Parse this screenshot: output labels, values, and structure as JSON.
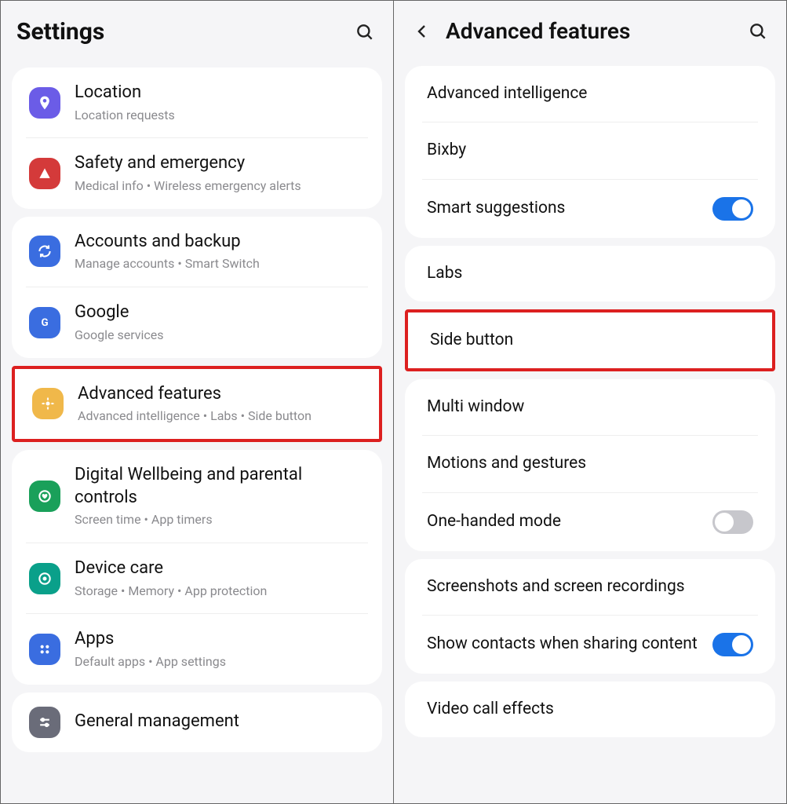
{
  "left": {
    "title": "Settings",
    "groups": [
      [
        {
          "icon": "location-icon",
          "iconClass": "ic-violet",
          "title": "Location",
          "sub": "Location requests"
        },
        {
          "icon": "warning-icon",
          "iconClass": "ic-red",
          "title": "Safety and emergency",
          "sub": "Medical info  •  Wireless emergency alerts"
        }
      ],
      [
        {
          "icon": "sync-icon",
          "iconClass": "ic-blue",
          "title": "Accounts and backup",
          "sub": "Manage accounts  •  Smart Switch"
        },
        {
          "icon": "google-icon",
          "iconClass": "ic-blue2",
          "title": "Google",
          "sub": "Google services"
        }
      ]
    ],
    "highlighted": {
      "icon": "gear-star-icon",
      "iconClass": "ic-yellow",
      "title": "Advanced features",
      "sub": "Advanced intelligence  •  Labs  •  Side button"
    },
    "groups2": [
      [
        {
          "icon": "heart-circle-icon",
          "iconClass": "ic-green",
          "title": "Digital Wellbeing and parental controls",
          "sub": "Screen time  •  App timers"
        },
        {
          "icon": "shield-check-icon",
          "iconClass": "ic-teal",
          "title": "Device care",
          "sub": "Storage  •  Memory  •  App protection"
        },
        {
          "icon": "apps-grid-icon",
          "iconClass": "ic-bluei",
          "title": "Apps",
          "sub": "Default apps  •  App settings"
        }
      ],
      [
        {
          "icon": "sliders-icon",
          "iconClass": "ic-grey",
          "title": "General management",
          "sub": ""
        }
      ]
    ]
  },
  "right": {
    "title": "Advanced features",
    "groups": [
      [
        {
          "title": "Advanced intelligence",
          "toggle": null
        },
        {
          "title": "Bixby",
          "toggle": null
        },
        {
          "title": "Smart suggestions",
          "toggle": "on"
        }
      ],
      [
        {
          "title": "Labs",
          "toggle": null
        }
      ]
    ],
    "highlighted": {
      "title": "Side button",
      "toggle": null
    },
    "groups2": [
      [
        {
          "title": "Multi window",
          "toggle": null
        },
        {
          "title": "Motions and gestures",
          "toggle": null
        },
        {
          "title": "One-handed mode",
          "toggle": "off"
        }
      ],
      [
        {
          "title": "Screenshots and screen recordings",
          "toggle": null
        },
        {
          "title": "Show contacts when sharing content",
          "toggle": "on"
        }
      ],
      [
        {
          "title": "Video call effects",
          "toggle": null
        }
      ]
    ]
  }
}
